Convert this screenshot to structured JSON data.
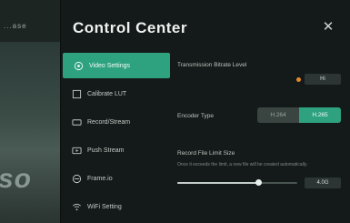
{
  "background_app": {
    "top_label": "...ase",
    "big_text": "so"
  },
  "panel": {
    "title": "Control Center",
    "close_icon": "close-icon"
  },
  "menu": {
    "items": [
      {
        "label": "Video Settings",
        "icon": "camera-icon",
        "active": true
      },
      {
        "label": "Calibrate LUT",
        "icon": "lut-icon",
        "active": false
      },
      {
        "label": "Record/Stream",
        "icon": "record-icon",
        "active": false
      },
      {
        "label": "Push Stream",
        "icon": "push-icon",
        "active": false
      },
      {
        "label": "Frame.io",
        "icon": "frameio-icon",
        "active": false
      },
      {
        "label": "WiFi Setting",
        "icon": "wifi-icon",
        "active": false
      }
    ]
  },
  "settings": {
    "transmission_label": "Transmission Bitrate Level",
    "transmission_value": "Hi",
    "encoder_label": "Encoder Type",
    "encoder_options": [
      "H.264",
      "H.265"
    ],
    "encoder_selected": "H.265",
    "record_label": "Record File Limit Size",
    "record_desc": "Once it exceeds the limit, a new file will be created automatically.",
    "record_value": "4.0G",
    "record_fraction": 0.68
  },
  "colors": {
    "accent": "#2ea27f",
    "indicator": "#e08a2e"
  }
}
